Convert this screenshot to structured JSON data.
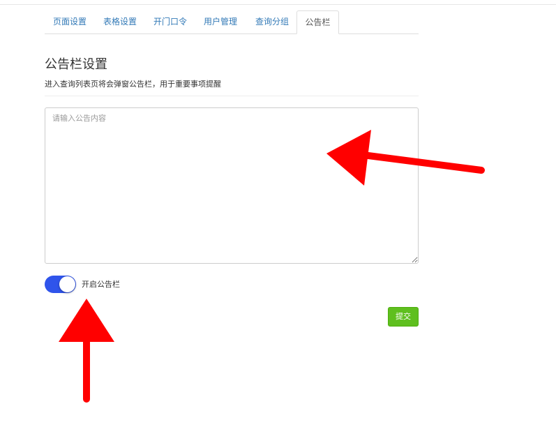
{
  "tabs": [
    {
      "label": "页面设置"
    },
    {
      "label": "表格设置"
    },
    {
      "label": "开门口令"
    },
    {
      "label": "用户管理"
    },
    {
      "label": "查询分组"
    },
    {
      "label": "公告栏"
    }
  ],
  "active_tab": "公告栏",
  "section": {
    "title": "公告栏设置",
    "description": "进入查询列表页将会弹窗公告栏，用于重要事项提醒"
  },
  "notice": {
    "placeholder": "请输入公告内容",
    "value": ""
  },
  "toggle": {
    "label": "开启公告栏",
    "enabled": true
  },
  "submit": {
    "label": "提交"
  },
  "colors": {
    "link": "#337ab7",
    "toggle_on": "#2f54eb",
    "submit": "#5fbf1f",
    "arrow": "#ff0000"
  },
  "icons": [
    "arrow-icon"
  ]
}
